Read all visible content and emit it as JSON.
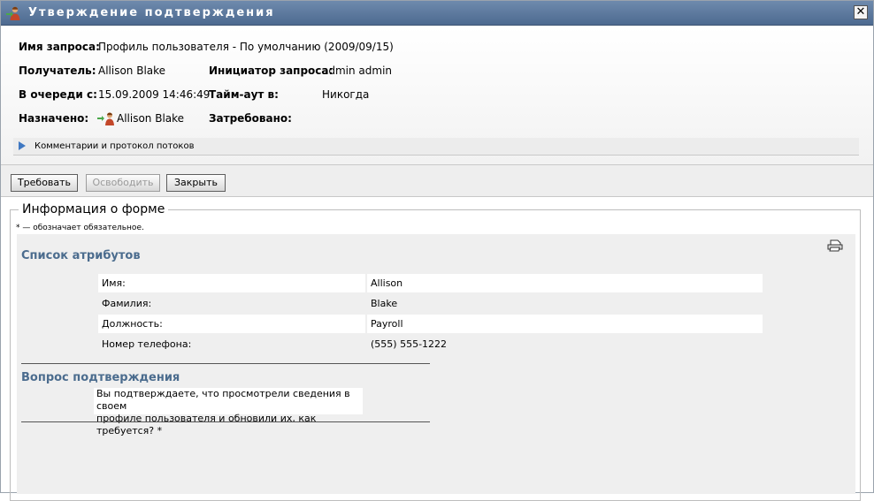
{
  "window": {
    "title": "Утверждение подтверждения",
    "title_icon": "user-approval-icon",
    "close_label": "✕"
  },
  "header": {
    "request_name_label": "Имя запроса:",
    "request_name_value": "Профиль пользователя - По умолчанию (2009/09/15)",
    "recipient_label": "Получатель:",
    "recipient_value": "Allison Blake",
    "initiator_label": "Инициатор запроса:",
    "initiator_value": "admin admin",
    "queued_label": "В очереди с:",
    "queued_value": "15.09.2009 14:46:49",
    "timeout_label": "Тайм-аут в:",
    "timeout_value": "Никогда",
    "assigned_label": "Назначено:",
    "assigned_value": "Allison Blake",
    "claimed_label": "Затребовано:",
    "comments_link": "Комментарии и протокол потоков"
  },
  "actions": {
    "claim": "Требовать",
    "release": "Освободить",
    "close": "Закрыть"
  },
  "form": {
    "legend": "Информация о форме",
    "required_note": "* — обозначает обязательное.",
    "attributes_heading": "Список атрибутов",
    "attributes": [
      {
        "label": "Имя:",
        "value": "Allison"
      },
      {
        "label": "Фамилия:",
        "value": "Blake"
      },
      {
        "label": "Должность:",
        "value": "Payroll"
      },
      {
        "label": "Номер телефона:",
        "value": "(555) 555-1222"
      }
    ],
    "question_heading": "Вопрос подтверждения",
    "question_line1": "Вы подтверждаете, что просмотрели сведения в своем",
    "question_line2": "профиле пользователя и обновили их, как требуется? *"
  },
  "colors": {
    "titlebar": "#5a779b",
    "heading": "#4b6c8e",
    "panel": "#efefef"
  }
}
